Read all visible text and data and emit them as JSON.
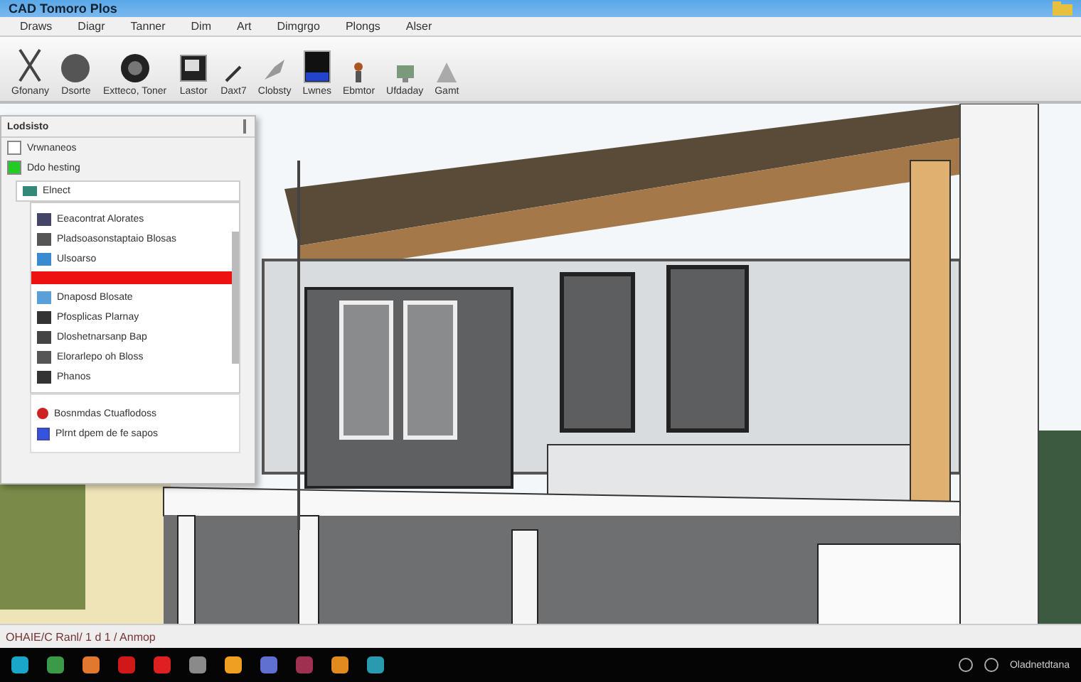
{
  "window": {
    "title": "CAD Tomoro Plos"
  },
  "menu": [
    {
      "label": "Draws"
    },
    {
      "label": "Diagr"
    },
    {
      "label": "Tanner"
    },
    {
      "label": "Dim"
    },
    {
      "label": "Art"
    },
    {
      "label": "Dimgrgo"
    },
    {
      "label": "Plongs"
    },
    {
      "label": "Alser"
    }
  ],
  "toolbar": [
    {
      "label": "Gfonany"
    },
    {
      "label": "Dsorte"
    },
    {
      "label": "Extteco, Toner"
    },
    {
      "label": "Lastor"
    },
    {
      "label": "Daxt7"
    },
    {
      "label": "Clobsty"
    },
    {
      "label": "Lwnes"
    },
    {
      "label": "Ebmtor"
    },
    {
      "label": "Ufdaday"
    },
    {
      "label": "Gamt"
    }
  ],
  "panel": {
    "title": "Lodsisto",
    "rows": [
      {
        "label": "Vrwnaneos",
        "checked": false
      },
      {
        "label": "Ddo hesting",
        "checked": true
      }
    ],
    "dropdown": {
      "value": "Elnect",
      "items": [
        {
          "label": "Eeacontrat Alorates",
          "selected": false
        },
        {
          "label": "Pladsoasonstaptaio Blosas",
          "selected": false
        },
        {
          "label": "Ulsoarso",
          "selected": false
        },
        {
          "selected": true
        },
        {
          "label": "Dnaposd Blosate",
          "selected": false
        },
        {
          "label": "Pfosplicas Plarnay",
          "selected": false
        },
        {
          "label": "Dloshetnarsanp Bap",
          "selected": false
        },
        {
          "label": "Elorarlepo oh Bloss",
          "selected": false
        },
        {
          "label": "Phanos",
          "selected": false
        }
      ]
    },
    "footer": [
      {
        "label": "Bosnmdas Ctuaflodoss",
        "kind": "dot",
        "color": "#cc2222"
      },
      {
        "label": "Plrnt dpem de fe sapos",
        "kind": "checkbox",
        "checked": true
      }
    ]
  },
  "status_bar": {
    "text": "OHAIE/C Ranl/ 1 d 1 / Anmop"
  },
  "taskbar": {
    "apps": [
      {
        "color": "#1aa6c8"
      },
      {
        "color": "#3a9a48"
      },
      {
        "color": "#e07830"
      },
      {
        "color": "#d01818"
      },
      {
        "color": "#e02020"
      },
      {
        "color": "#8a8a8a"
      },
      {
        "color": "#f0a020"
      },
      {
        "color": "#6070d0"
      },
      {
        "color": "#a03050"
      },
      {
        "color": "#e08a20"
      },
      {
        "color": "#2a9ab0"
      }
    ],
    "clock": "Oladnetdtana"
  }
}
